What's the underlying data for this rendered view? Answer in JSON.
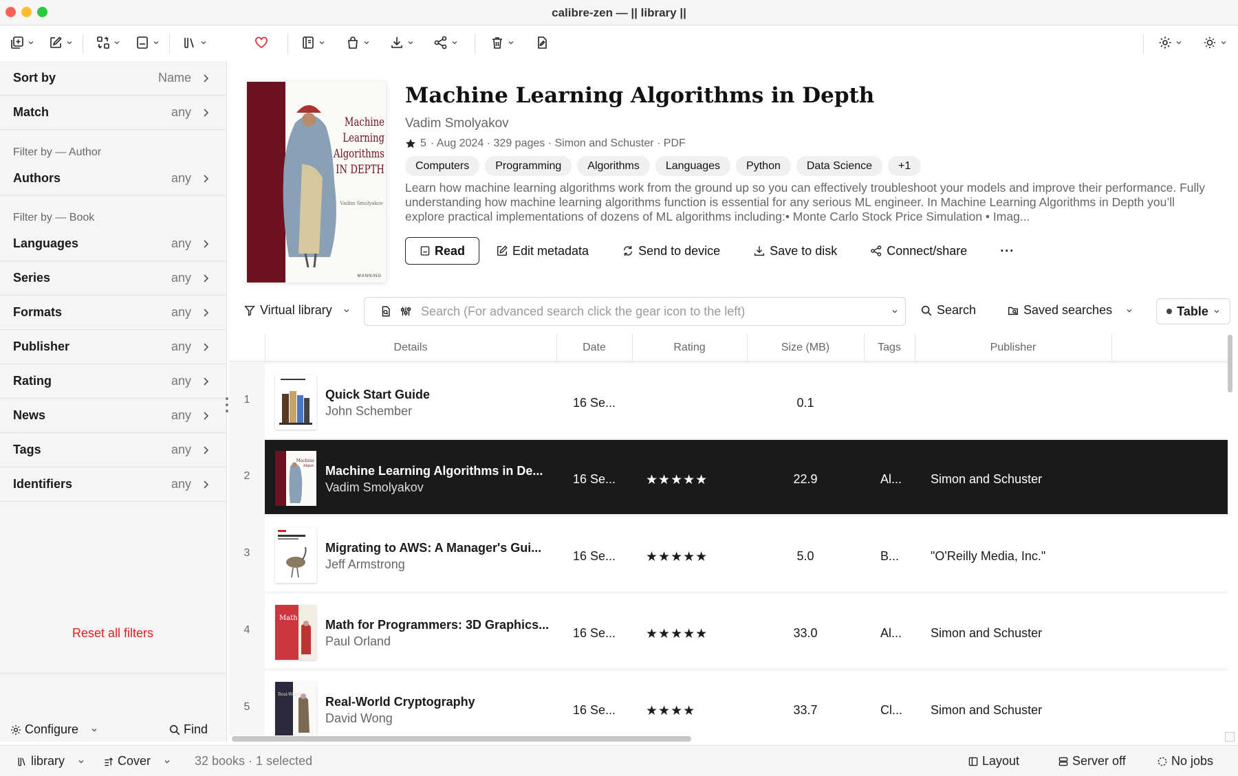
{
  "window": {
    "title": "calibre-zen — || library ||"
  },
  "colors": {
    "accent": "#e02020",
    "selected_row": "#1a1a1a",
    "heart": "#e0303e"
  },
  "toolbar": {
    "icons": [
      "add-book-icon",
      "edit-metadata-icon",
      "convert-icon",
      "view-icon",
      "library-icon",
      "favorite-icon",
      "reader-icon",
      "store-icon",
      "save-download-icon",
      "share-icon",
      "delete-icon",
      "edit-book-icon",
      "settings-icon",
      "theme-icon"
    ]
  },
  "sidebar": {
    "sort": {
      "label": "Sort by",
      "value": "Name"
    },
    "match": {
      "label": "Match",
      "value": "any"
    },
    "filter_author_heading": "Filter by — Author",
    "author_filters": [
      {
        "label": "Authors",
        "value": "any"
      }
    ],
    "filter_book_heading": "Filter by — Book",
    "book_filters": [
      {
        "label": "Languages",
        "value": "any"
      },
      {
        "label": "Series",
        "value": "any"
      },
      {
        "label": "Formats",
        "value": "any"
      },
      {
        "label": "Publisher",
        "value": "any"
      },
      {
        "label": "Rating",
        "value": "any"
      },
      {
        "label": "News",
        "value": "any"
      },
      {
        "label": "Tags",
        "value": "any"
      },
      {
        "label": "Identifiers",
        "value": "any"
      }
    ],
    "reset_label": "Reset all filters",
    "configure_label": "Configure",
    "find_label": "Find"
  },
  "details": {
    "title": "Machine Learning Algorithms in Depth",
    "author": "Vadim Smolyakov",
    "rating": "5",
    "meta": "· Aug 2024 · 329 pages · Simon and Schuster · PDF",
    "tags": [
      "Computers",
      "Programming",
      "Algorithms",
      "Languages",
      "Python",
      "Data Science",
      "+1"
    ],
    "description": "Learn how machine learning algorithms work from the ground up so you can effectively troubleshoot your models and improve their performance. Fully understanding how machine learning algorithms function is essential for any serious ML engineer. In Machine Learning Algorithms in Depth you’ll explore practical implementations of dozens of ML algorithms including:• Monte Carlo Stock Price Simulation • Imag...",
    "actions": {
      "read": "Read",
      "edit": "Edit metadata",
      "send": "Send to device",
      "save": "Save to disk",
      "connect": "Connect/share",
      "more": "···"
    },
    "cover": {
      "line1": "Machine Learning",
      "line2": "Algorithms",
      "line3": "IN DEPTH",
      "author": "Vadim Smolyakov",
      "publisher": "MANNING"
    }
  },
  "search": {
    "virtual_library": "Virtual library",
    "placeholder": "Search (For advanced search click the gear icon to the left)",
    "search_button": "Search",
    "saved_searches": "Saved searches",
    "view_mode": "Table"
  },
  "table": {
    "columns": [
      "Details",
      "Date",
      "Rating",
      "Size (MB)",
      "Tags",
      "Publisher"
    ],
    "rows": [
      {
        "num": "1",
        "title": "Quick Start Guide",
        "author": "John Schember",
        "date": "16 Se...",
        "rating": "",
        "size": "0.1",
        "tags": "",
        "publisher": "",
        "selected": false
      },
      {
        "num": "2",
        "title": "Machine Learning Algorithms in De...",
        "author": "Vadim Smolyakov",
        "date": "16 Se...",
        "rating": "★★★★★",
        "size": "22.9",
        "tags": "Al...",
        "publisher": "Simon and Schuster",
        "selected": true
      },
      {
        "num": "3",
        "title": "Migrating to AWS: A Manager's Gui...",
        "author": "Jeff Armstrong",
        "date": "16 Se...",
        "rating": "★★★★★",
        "size": "5.0",
        "tags": "B...",
        "publisher": "\"O'Reilly Media, Inc.\"",
        "selected": false
      },
      {
        "num": "4",
        "title": "Math for Programmers: 3D Graphics...",
        "author": "Paul Orland",
        "date": "16 Se...",
        "rating": "★★★★★",
        "size": "33.0",
        "tags": "Al...",
        "publisher": "Simon and Schuster",
        "selected": false
      },
      {
        "num": "5",
        "title": "Real-World Cryptography",
        "author": "David Wong",
        "date": "16 Se...",
        "rating": "★★★★",
        "size": "33.7",
        "tags": "Cl...",
        "publisher": "Simon and Schuster",
        "selected": false
      }
    ]
  },
  "status": {
    "library": "library",
    "cover": "Cover",
    "count": "32 books · 1 selected",
    "layout": "Layout",
    "server": "Server off",
    "jobs": "No jobs"
  }
}
